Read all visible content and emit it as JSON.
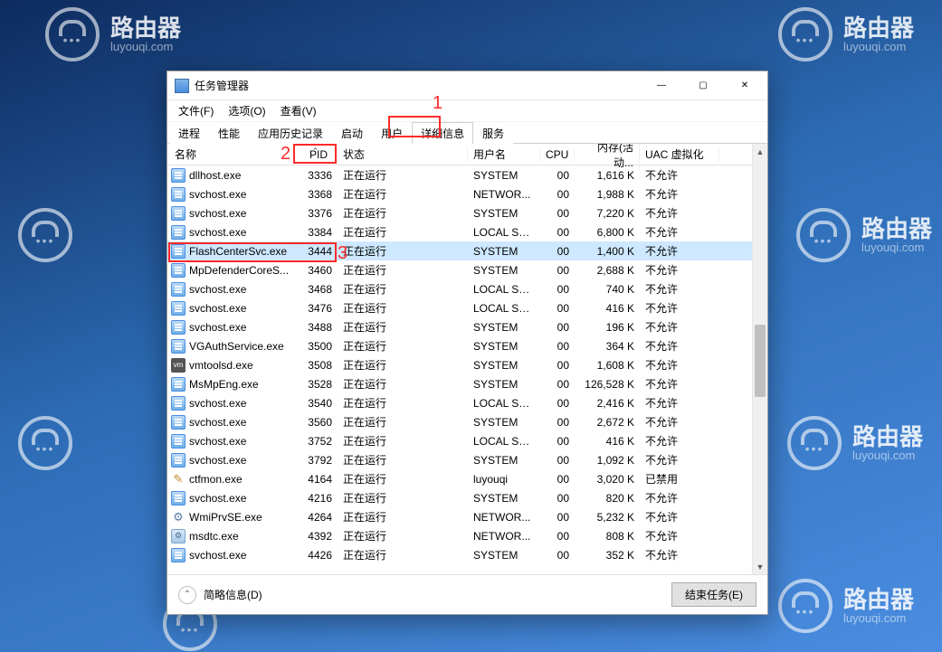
{
  "watermark": {
    "cn": "路由器",
    "en": "luyouqi.com"
  },
  "window": {
    "title": "任务管理器",
    "controls": {
      "min": "—",
      "max": "▢",
      "close": "✕"
    }
  },
  "menubar": [
    "文件(F)",
    "选项(O)",
    "查看(V)"
  ],
  "tabs": {
    "items": [
      "进程",
      "性能",
      "应用历史记录",
      "启动",
      "用户",
      "详细信息",
      "服务"
    ],
    "active_index": 5
  },
  "columns": {
    "name": "名称",
    "pid": "PID",
    "status": "状态",
    "user": "用户名",
    "cpu": "CPU",
    "mem": "内存(活动...",
    "uac": "UAC 虚拟化"
  },
  "rows": [
    {
      "icon": "app",
      "name": "dllhost.exe",
      "pid": "3336",
      "status": "正在运行",
      "user": "SYSTEM",
      "cpu": "00",
      "mem": "1,616 K",
      "uac": "不允许",
      "sel": false
    },
    {
      "icon": "app",
      "name": "svchost.exe",
      "pid": "3368",
      "status": "正在运行",
      "user": "NETWOR...",
      "cpu": "00",
      "mem": "1,988 K",
      "uac": "不允许",
      "sel": false
    },
    {
      "icon": "app",
      "name": "svchost.exe",
      "pid": "3376",
      "status": "正在运行",
      "user": "SYSTEM",
      "cpu": "00",
      "mem": "7,220 K",
      "uac": "不允许",
      "sel": false
    },
    {
      "icon": "app",
      "name": "svchost.exe",
      "pid": "3384",
      "status": "正在运行",
      "user": "LOCAL SE...",
      "cpu": "00",
      "mem": "6,800 K",
      "uac": "不允许",
      "sel": false
    },
    {
      "icon": "app",
      "name": "FlashCenterSvc.exe",
      "pid": "3444",
      "status": "正在运行",
      "user": "SYSTEM",
      "cpu": "00",
      "mem": "1,400 K",
      "uac": "不允许",
      "sel": true
    },
    {
      "icon": "app",
      "name": "MpDefenderCoreS...",
      "pid": "3460",
      "status": "正在运行",
      "user": "SYSTEM",
      "cpu": "00",
      "mem": "2,688 K",
      "uac": "不允许",
      "sel": false
    },
    {
      "icon": "app",
      "name": "svchost.exe",
      "pid": "3468",
      "status": "正在运行",
      "user": "LOCAL SE...",
      "cpu": "00",
      "mem": "740 K",
      "uac": "不允许",
      "sel": false
    },
    {
      "icon": "app",
      "name": "svchost.exe",
      "pid": "3476",
      "status": "正在运行",
      "user": "LOCAL SE...",
      "cpu": "00",
      "mem": "416 K",
      "uac": "不允许",
      "sel": false
    },
    {
      "icon": "app",
      "name": "svchost.exe",
      "pid": "3488",
      "status": "正在运行",
      "user": "SYSTEM",
      "cpu": "00",
      "mem": "196 K",
      "uac": "不允许",
      "sel": false
    },
    {
      "icon": "app",
      "name": "VGAuthService.exe",
      "pid": "3500",
      "status": "正在运行",
      "user": "SYSTEM",
      "cpu": "00",
      "mem": "364 K",
      "uac": "不允许",
      "sel": false
    },
    {
      "icon": "vm",
      "name": "vmtoolsd.exe",
      "pid": "3508",
      "status": "正在运行",
      "user": "SYSTEM",
      "cpu": "00",
      "mem": "1,608 K",
      "uac": "不允许",
      "sel": false
    },
    {
      "icon": "app",
      "name": "MsMpEng.exe",
      "pid": "3528",
      "status": "正在运行",
      "user": "SYSTEM",
      "cpu": "00",
      "mem": "126,528 K",
      "uac": "不允许",
      "sel": false
    },
    {
      "icon": "app",
      "name": "svchost.exe",
      "pid": "3540",
      "status": "正在运行",
      "user": "LOCAL SE...",
      "cpu": "00",
      "mem": "2,416 K",
      "uac": "不允许",
      "sel": false
    },
    {
      "icon": "app",
      "name": "svchost.exe",
      "pid": "3560",
      "status": "正在运行",
      "user": "SYSTEM",
      "cpu": "00",
      "mem": "2,672 K",
      "uac": "不允许",
      "sel": false
    },
    {
      "icon": "app",
      "name": "svchost.exe",
      "pid": "3752",
      "status": "正在运行",
      "user": "LOCAL SE...",
      "cpu": "00",
      "mem": "416 K",
      "uac": "不允许",
      "sel": false
    },
    {
      "icon": "app",
      "name": "svchost.exe",
      "pid": "3792",
      "status": "正在运行",
      "user": "SYSTEM",
      "cpu": "00",
      "mem": "1,092 K",
      "uac": "不允许",
      "sel": false
    },
    {
      "icon": "pen",
      "name": "ctfmon.exe",
      "pid": "4164",
      "status": "正在运行",
      "user": "luyouqi",
      "cpu": "00",
      "mem": "3,020 K",
      "uac": "已禁用",
      "sel": false
    },
    {
      "icon": "app",
      "name": "svchost.exe",
      "pid": "4216",
      "status": "正在运行",
      "user": "SYSTEM",
      "cpu": "00",
      "mem": "820 K",
      "uac": "不允许",
      "sel": false
    },
    {
      "icon": "gear",
      "name": "WmiPrvSE.exe",
      "pid": "4264",
      "status": "正在运行",
      "user": "NETWOR...",
      "cpu": "00",
      "mem": "5,232 K",
      "uac": "不允许",
      "sel": false
    },
    {
      "icon": "svc",
      "name": "msdtc.exe",
      "pid": "4392",
      "status": "正在运行",
      "user": "NETWOR...",
      "cpu": "00",
      "mem": "808 K",
      "uac": "不允许",
      "sel": false
    },
    {
      "icon": "app",
      "name": "svchost.exe",
      "pid": "4426",
      "status": "正在运行",
      "user": "SYSTEM",
      "cpu": "00",
      "mem": "352 K",
      "uac": "不允许",
      "sel": false
    }
  ],
  "footer": {
    "fewer": "简略信息(D)",
    "end_task": "结束任务(E)"
  },
  "annotations": {
    "n1": "1",
    "n2": "2",
    "n3": "3"
  }
}
